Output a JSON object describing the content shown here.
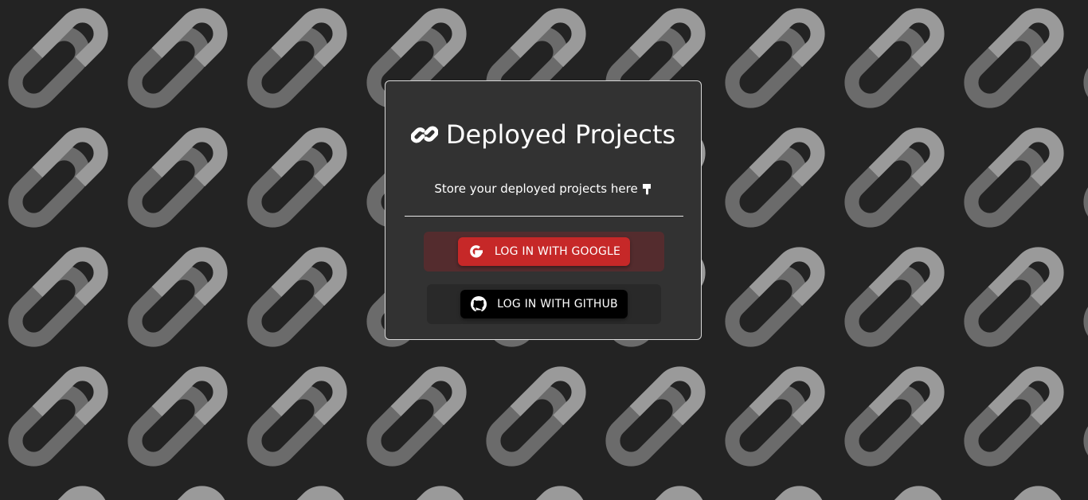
{
  "app": {
    "title": "Deployed Projects",
    "subtitle": "Store your deployed projects here"
  },
  "icons": {
    "title_icon": "link-icon",
    "subtitle_icon": "hand-pointing-down-icon",
    "background_pattern": "link-icon",
    "google_icon": "google-icon",
    "github_icon": "github-icon"
  },
  "buttons": {
    "google_label": "LOG IN WITH GOOGLE",
    "github_label": "LOG IN WITH GITHUB"
  },
  "colors": {
    "background": "#232323",
    "card": "#323232",
    "google": "#c62828",
    "github": "#000000",
    "pattern_light": "#9a9a9a",
    "pattern_dark": "#6b6b6b"
  }
}
